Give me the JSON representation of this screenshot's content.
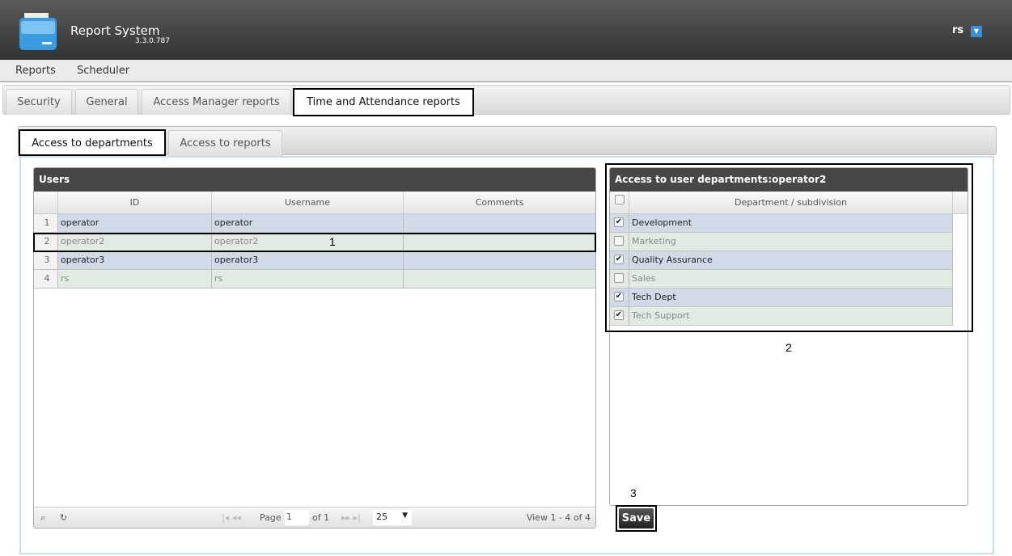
{
  "app": {
    "title": "Report System",
    "version": "3.3.0.787",
    "user": "rs"
  },
  "menu": [
    "Reports",
    "Scheduler"
  ],
  "tabs": [
    "Security",
    "General",
    "Access Manager reports",
    "Time and Attendance reports"
  ],
  "subtabs": [
    "Access to departments",
    "Access to reports"
  ],
  "users": {
    "title": "Users",
    "columns": [
      "ID",
      "Username",
      "Comments"
    ],
    "rows": [
      {
        "n": "1",
        "id": "operator",
        "username": "operator",
        "comments": ""
      },
      {
        "n": "2",
        "id": "operator2",
        "username": "operator2",
        "comments": ""
      },
      {
        "n": "3",
        "id": "operator3",
        "username": "operator3",
        "comments": ""
      },
      {
        "n": "4",
        "id": "rs",
        "username": "rs",
        "comments": ""
      }
    ],
    "pager": {
      "page_label": "Page",
      "page": "1",
      "of": "of 1",
      "page_size": "25",
      "view": "View 1 - 4 of 4"
    }
  },
  "departments": {
    "title": "Access to user departments:operator2",
    "column": "Department / subdivision",
    "rows": [
      {
        "name": "Development",
        "checked": true
      },
      {
        "name": "Marketing",
        "checked": false
      },
      {
        "name": "Quality Assurance",
        "checked": true
      },
      {
        "name": "Sales",
        "checked": false
      },
      {
        "name": "Tech Dept",
        "checked": true
      },
      {
        "name": "Tech Support",
        "checked": true
      }
    ]
  },
  "save_label": "Save",
  "annotations": [
    "1",
    "2",
    "3"
  ]
}
